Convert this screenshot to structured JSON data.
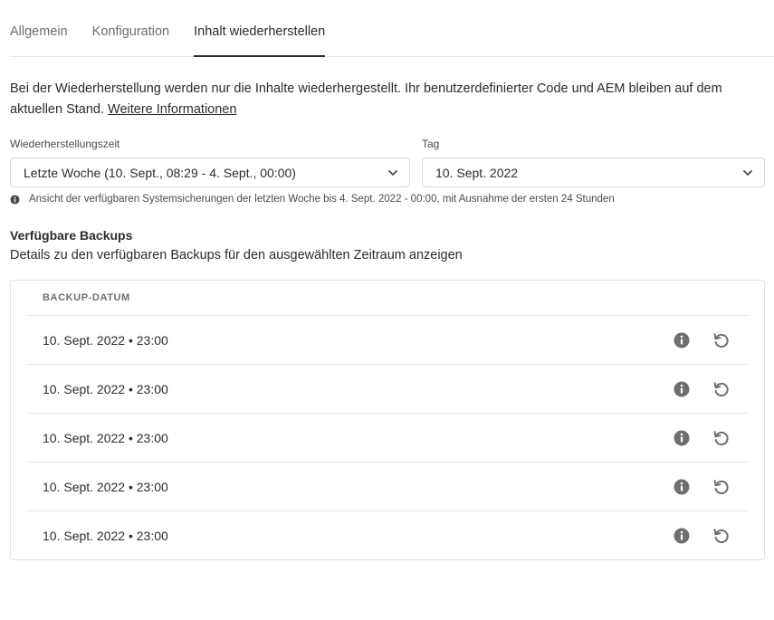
{
  "tabs": [
    {
      "label": "Allgemein",
      "active": false
    },
    {
      "label": "Konfiguration",
      "active": false
    },
    {
      "label": "Inhalt wiederherstellen",
      "active": true
    }
  ],
  "description": {
    "text": "Bei der Wiederherstellung werden nur die Inhalte wiederhergestellt. Ihr benutzerdefinierter Code und AEM bleiben auf dem aktuellen Stand. ",
    "link": "Weitere Informationen"
  },
  "restore_time": {
    "label": "Wiederherstellungszeit",
    "value": "Letzte Woche (10. Sept., 08:29 - 4. Sept., 00:00)"
  },
  "day": {
    "label": "Tag",
    "value": "10. Sept. 2022"
  },
  "help_text": "Ansicht der verfügbaren Systemsicherungen der letzten Woche bis 4. Sept. 2022 - 00:00, mit Ausnahme der ersten 24 Stunden",
  "backups": {
    "title": "Verfügbare Backups",
    "subtitle": "Details zu den verfügbaren Backups für den ausgewählten Zeitraum anzeigen",
    "column_header": "BACKUP-DATUM",
    "rows": [
      {
        "date": "10. Sept. 2022 • 23:00"
      },
      {
        "date": "10. Sept. 2022 • 23:00"
      },
      {
        "date": "10. Sept. 2022 • 23:00"
      },
      {
        "date": "10. Sept. 2022 • 23:00"
      },
      {
        "date": "10. Sept. 2022 • 23:00"
      }
    ]
  },
  "icons": {
    "row_info": "info-icon",
    "row_restore": "restore-icon",
    "picker": "chevron-down-icon",
    "help": "info-icon"
  },
  "colors": {
    "text": "#2c2c2c",
    "muted": "#6e6e6e",
    "border": "#e1e1e1",
    "icon": "#6e6e6e"
  }
}
